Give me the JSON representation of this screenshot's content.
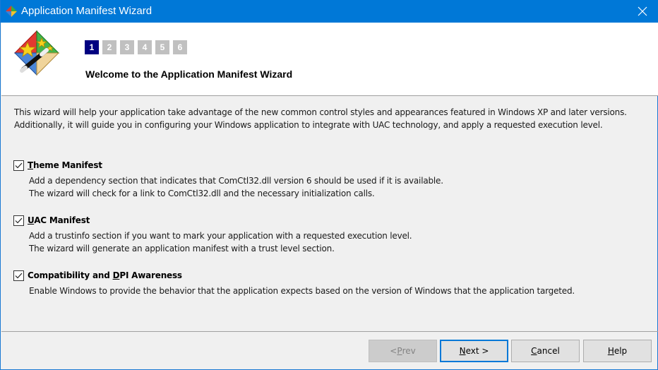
{
  "window": {
    "title": "Application Manifest Wizard",
    "icon": "wizard-app-icon",
    "close_icon": "close-icon"
  },
  "header": {
    "logo_icon": "magic-wand-wizard-icon",
    "steps": [
      "1",
      "2",
      "3",
      "4",
      "5",
      "6"
    ],
    "active_step": "1",
    "title": "Welcome to the Application Manifest Wizard"
  },
  "intro": {
    "line1": "This wizard will help your application take advantage of the new common control styles and appearances featured in Windows XP and later versions.",
    "line2": "Additionally, it will guide you in configuring your Windows application to integrate with UAC technology, and apply a requested execution level."
  },
  "options": [
    {
      "label_pre": "",
      "label_accel": "T",
      "label_post": "heme Manifest",
      "checked": true,
      "desc1": "Add a dependency section that indicates that ComCtl32.dll version 6 should be used if it is available.",
      "desc2": "The wizard will check for a link to ComCtl32.dll and the necessary initialization calls."
    },
    {
      "label_pre": "",
      "label_accel": "U",
      "label_post": "AC Manifest",
      "checked": true,
      "desc1": "Add a trustinfo section if you want to mark your application with a requested execution level.",
      "desc2": "The wizard will generate an application manifest with a trust level section."
    },
    {
      "label_pre": "Compatibility and ",
      "label_accel": "D",
      "label_post": "PI Awareness",
      "checked": true,
      "desc1": "Enable Windows to provide the behavior that the application expects based on the version of Windows that the application targeted.",
      "desc2": ""
    }
  ],
  "buttons": {
    "prev": {
      "pre": "< ",
      "accel": "P",
      "post": "rev",
      "enabled": false
    },
    "next": {
      "pre": "",
      "accel": "N",
      "post": "ext >",
      "enabled": true,
      "default": true
    },
    "cancel": {
      "pre": "",
      "accel": "C",
      "post": "ancel",
      "enabled": true
    },
    "help": {
      "pre": "",
      "accel": "H",
      "post": "elp",
      "enabled": true
    }
  },
  "colors": {
    "titlebar": "#0078d7",
    "active_step": "#000080",
    "inactive_step": "#c0c0c0"
  }
}
